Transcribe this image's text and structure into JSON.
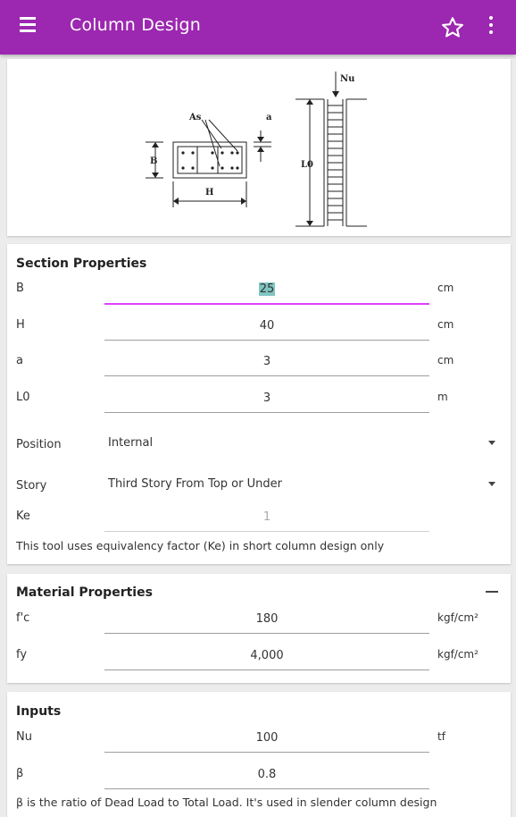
{
  "appbar": {
    "title": "Column Design"
  },
  "diagram": {
    "labels": {
      "as": "As",
      "a": "a",
      "b": "B",
      "h": "H",
      "nu": "Nu",
      "l0": "L0"
    }
  },
  "section": {
    "title": "Section Properties",
    "rows": [
      {
        "label": "B",
        "value": "25",
        "unit": "cm"
      },
      {
        "label": "H",
        "value": "40",
        "unit": "cm"
      },
      {
        "label": "a",
        "value": "3",
        "unit": "cm"
      },
      {
        "label": "L0",
        "value": "3",
        "unit": "m"
      }
    ],
    "position": {
      "label": "Position",
      "value": "Internal"
    },
    "story": {
      "label": "Story",
      "value": "Third Story From Top or Under"
    },
    "ke": {
      "label": "Ke",
      "value": "1"
    },
    "note": "This tool uses equivalency factor (Ke) in short column design only"
  },
  "material": {
    "title": "Material Properties",
    "rows": [
      {
        "label": "f'c",
        "value": "180",
        "unit": "kgf/cm²"
      },
      {
        "label": "fy",
        "value": "4,000",
        "unit": "kgf/cm²"
      }
    ]
  },
  "inputs": {
    "title": "Inputs",
    "rows": [
      {
        "label": "Nu",
        "value": "100",
        "unit": "tf"
      },
      {
        "label": "β",
        "value": "0.8"
      }
    ],
    "note": "β is the ratio of Dead Load to Total Load. It's used in slender column design"
  }
}
